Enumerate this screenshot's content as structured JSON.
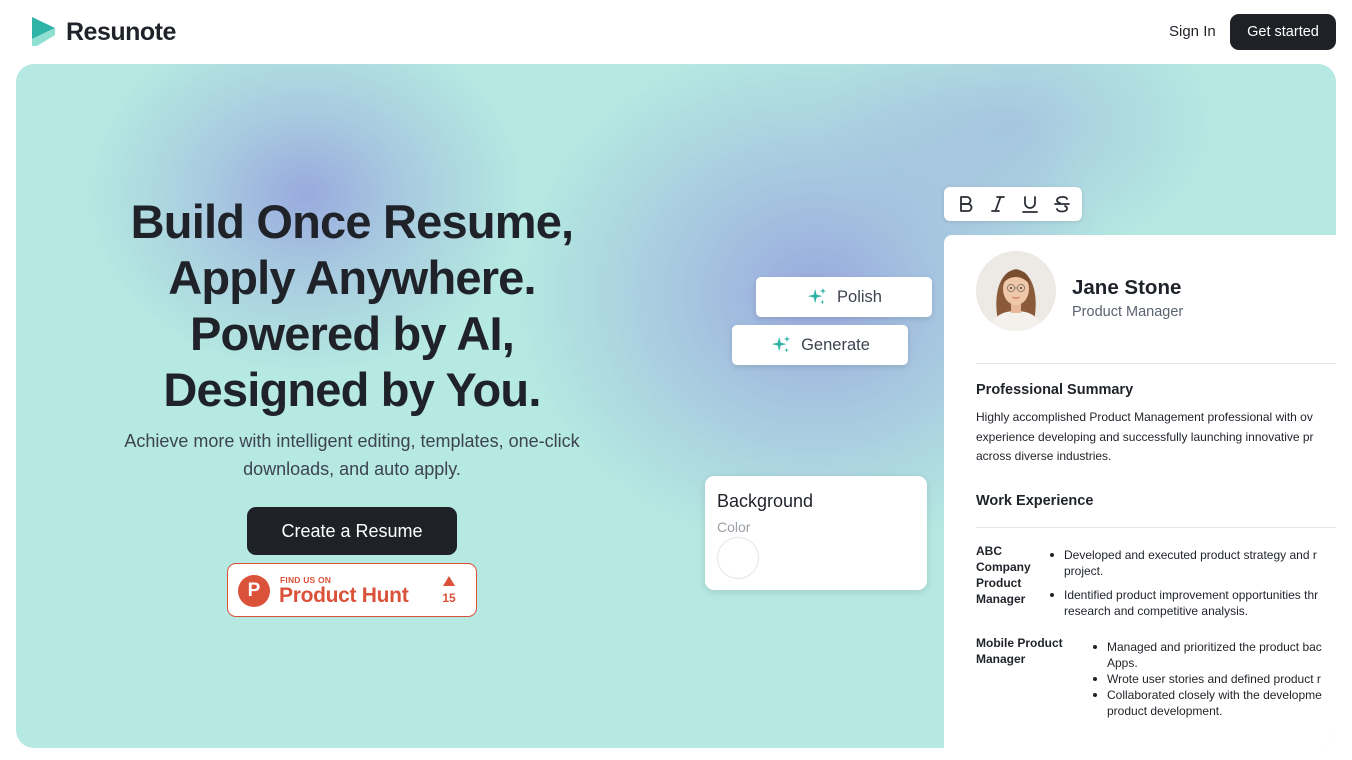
{
  "header": {
    "brand": "Resunote",
    "signin_label": "Sign In",
    "getstarted_label": "Get started"
  },
  "hero": {
    "headline": [
      "Build Once Resume,",
      "Apply Anywhere.",
      "Powered by AI,",
      "Designed by You."
    ],
    "subtext": [
      "Achieve more with intelligent editing, templates, one-click",
      "downloads, and auto apply."
    ],
    "cta_label": "Create a Resume",
    "product_hunt": {
      "small": "FIND US ON",
      "name": "Product Hunt",
      "count": "15"
    }
  },
  "editor": {
    "toolbar": [
      "bold-icon",
      "italic-icon",
      "underline-icon",
      "strikethrough-icon"
    ],
    "polish_label": "Polish",
    "generate_label": "Generate",
    "background_card": {
      "title": "Background",
      "subtitle": "Color"
    }
  },
  "resume": {
    "name": "Jane Stone",
    "role": "Product Manager",
    "summary_heading": "Professional Summary",
    "summary_lines": [
      "Highly accomplished Product Management professional with ov",
      "experience developing and successfully launching innovative pr",
      "across diverse industries."
    ],
    "work_heading": "Work Experience",
    "job1_label": [
      "ABC",
      "Company",
      "Product",
      "Manager"
    ],
    "job1_bullets": [
      [
        "Developed and executed product strategy and r",
        "project."
      ],
      [
        "Identified product improvement opportunities thr",
        "research and competitive analysis."
      ]
    ],
    "job2_label": [
      "Mobile Product",
      "Manager"
    ],
    "job2_bullets": [
      [
        "Managed and prioritized the product bac",
        "Apps."
      ],
      [
        "Wrote user stories and defined product r"
      ],
      [
        "Collaborated closely with the developme",
        "product development."
      ]
    ]
  },
  "colors": {
    "hero_bg": "#b5e9e1",
    "hero_glow": "#98a6de",
    "dark": "#1e2227",
    "product_hunt": "#da5239",
    "sparkle": "#2eb3a6"
  }
}
